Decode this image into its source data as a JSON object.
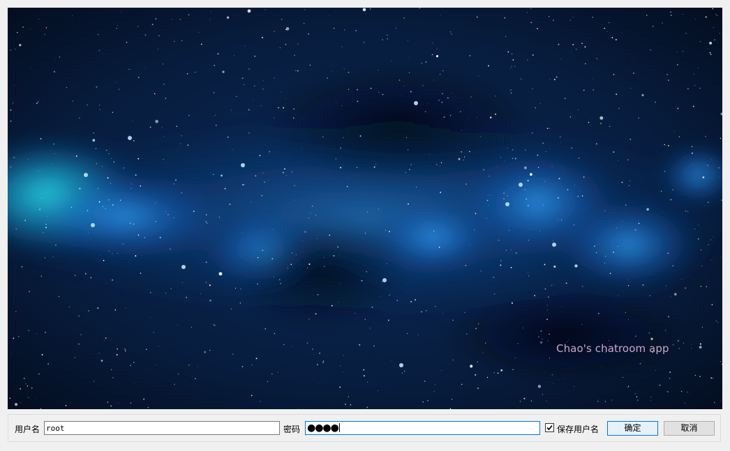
{
  "banner": {
    "caption": "Chao's chatroom app"
  },
  "login": {
    "username_label": "用户名",
    "username_value": "root",
    "password_label": "密码",
    "password_masked": "●●●●",
    "remember_label": "保存用户名",
    "remember_checked": true,
    "ok_label": "确定",
    "cancel_label": "取消"
  },
  "colors": {
    "focus_border": "#0078d7",
    "caption": "#c7a7c7",
    "sky_dark": "#061327",
    "nebula": "#1f7fd8"
  }
}
